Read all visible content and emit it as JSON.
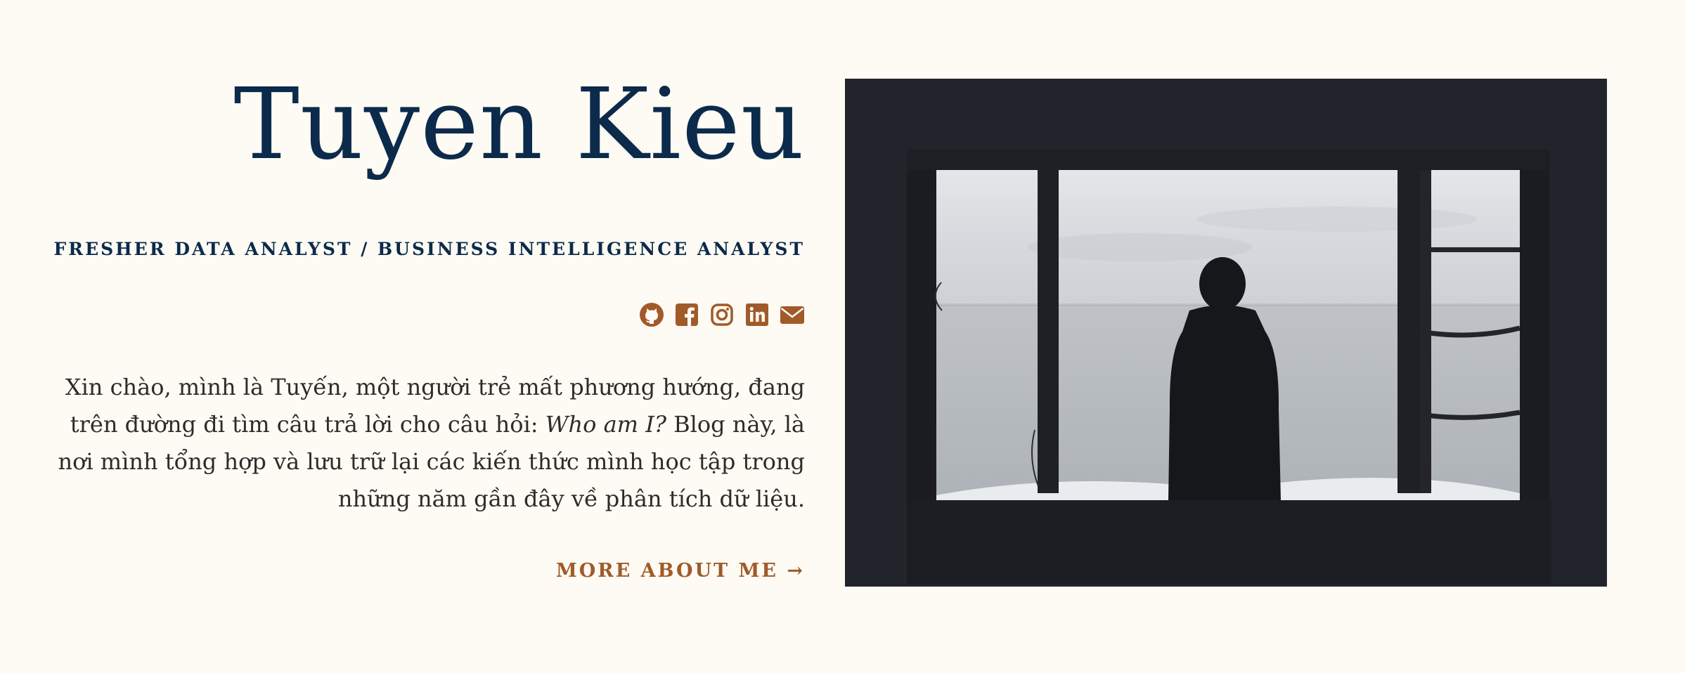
{
  "hero": {
    "name": "Tuyen Kieu",
    "subtitle": "FRESHER DATA ANALYST / BUSINESS INTELLIGENCE ANALYST",
    "intro_part1": "Xin chào, mình là Tuyến, một người trẻ mất phương hướng, đang trên đường đi tìm câu trả lời cho câu hỏi: ",
    "intro_em": "Who am I?",
    "intro_part2": " Blog này, là nơi mình tổng hợp và lưu trữ lại các kiến thức mình học tập trong những năm gần đây về phân tích dữ liệu.",
    "more_label": "MORE ABOUT ME →"
  },
  "social": [
    {
      "icon": "github-icon"
    },
    {
      "icon": "facebook-icon"
    },
    {
      "icon": "instagram-icon"
    },
    {
      "icon": "linkedin-icon"
    },
    {
      "icon": "email-icon"
    }
  ],
  "colors": {
    "background": "#fdfbf3",
    "heading": "#0c2a4b",
    "accent": "#a15a2a",
    "body_text": "#2c2c2c",
    "image_frame": "#21242a"
  }
}
